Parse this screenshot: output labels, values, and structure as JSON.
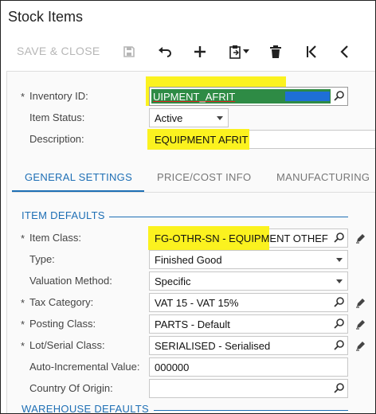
{
  "title": "Stock Items",
  "toolbar": {
    "save_close_label": "SAVE & CLOSE",
    "icons": [
      "save-icon",
      "undo-icon",
      "add-icon",
      "clipboard-icon",
      "chevron-down-icon",
      "delete-icon",
      "first-record-icon",
      "previous-record-icon"
    ]
  },
  "header": {
    "inventory_id": {
      "label": "Inventory ID:",
      "value": "UIPMENT_AFRIT",
      "required": "*"
    },
    "item_status": {
      "label": "Item Status:",
      "value": "Active"
    },
    "description": {
      "label": "Description:",
      "value": "EQUIPMENT AFRIT"
    }
  },
  "tabs": [
    {
      "label": "GENERAL SETTINGS",
      "active": true
    },
    {
      "label": "PRICE/COST INFO",
      "active": false
    },
    {
      "label": "MANUFACTURING",
      "active": false
    }
  ],
  "sections": {
    "item_defaults": "ITEM DEFAULTS",
    "warehouse_defaults": "WAREHOUSE DEFAULTS"
  },
  "fields": {
    "item_class": {
      "label": "Item Class:",
      "value": "FG-OTHR-SN - EQUIPMENT OTHEF",
      "required": "*"
    },
    "type": {
      "label": "Type:",
      "value": "Finished Good"
    },
    "valuation_method": {
      "label": "Valuation Method:",
      "value": "Specific"
    },
    "tax_category": {
      "label": "Tax Category:",
      "value": "VAT 15 - VAT 15%",
      "required": "*"
    },
    "posting_class": {
      "label": "Posting Class:",
      "value": "PARTS - Default",
      "required": "*"
    },
    "lot_serial_class": {
      "label": "Lot/Serial Class:",
      "value": "SERIALISED - Serialised",
      "required": "*"
    },
    "auto_incremental_value": {
      "label": "Auto-Incremental Value:",
      "value": "000000"
    },
    "country_of_origin": {
      "label": "Country Of Origin:",
      "value": ""
    }
  },
  "colors": {
    "accent": "#1e6fb5",
    "highlight": "#fbf21f",
    "selection": "#2e8b45"
  }
}
